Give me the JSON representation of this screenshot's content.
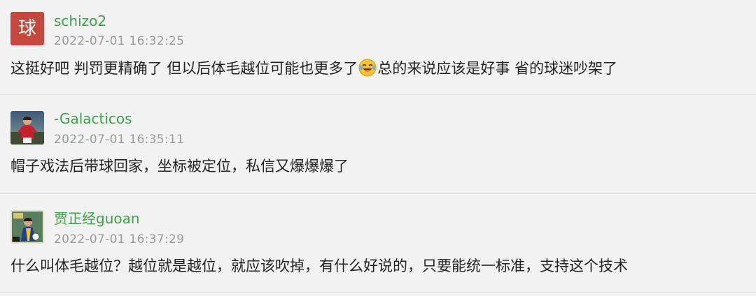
{
  "comments": [
    {
      "avatar_letter": "球",
      "username": "schizo2",
      "timestamp": "2022-07-01 16:32:25",
      "content_before_emoji": "这挺好吧 判罚更精确了 但以后体毛越位可能也更多了",
      "emoji": "laughing-crying-emoji",
      "content_after_emoji": "总的来说应该是好事 省的球迷吵架了"
    },
    {
      "avatar": "player-photo-avatar",
      "username": "-Galacticos",
      "timestamp": "2022-07-01 16:35:11",
      "content": "帽子戏法后带球回家，坐标被定位，私信又爆爆爆了"
    },
    {
      "avatar": "player-card-avatar",
      "username": "贾正经guoan",
      "timestamp": "2022-07-01 16:37:29",
      "content": "什么叫体毛越位？越位就是越位，就应该吹掉，有什么好说的，只要能统一标准，支持这个技术"
    }
  ],
  "colors": {
    "background": "#f2f2f2",
    "username": "#3aa44a",
    "timestamp": "#9a9a9a",
    "text": "#222222",
    "avatar_letter_bg": "#c4483d",
    "divider": "#dddddd"
  }
}
